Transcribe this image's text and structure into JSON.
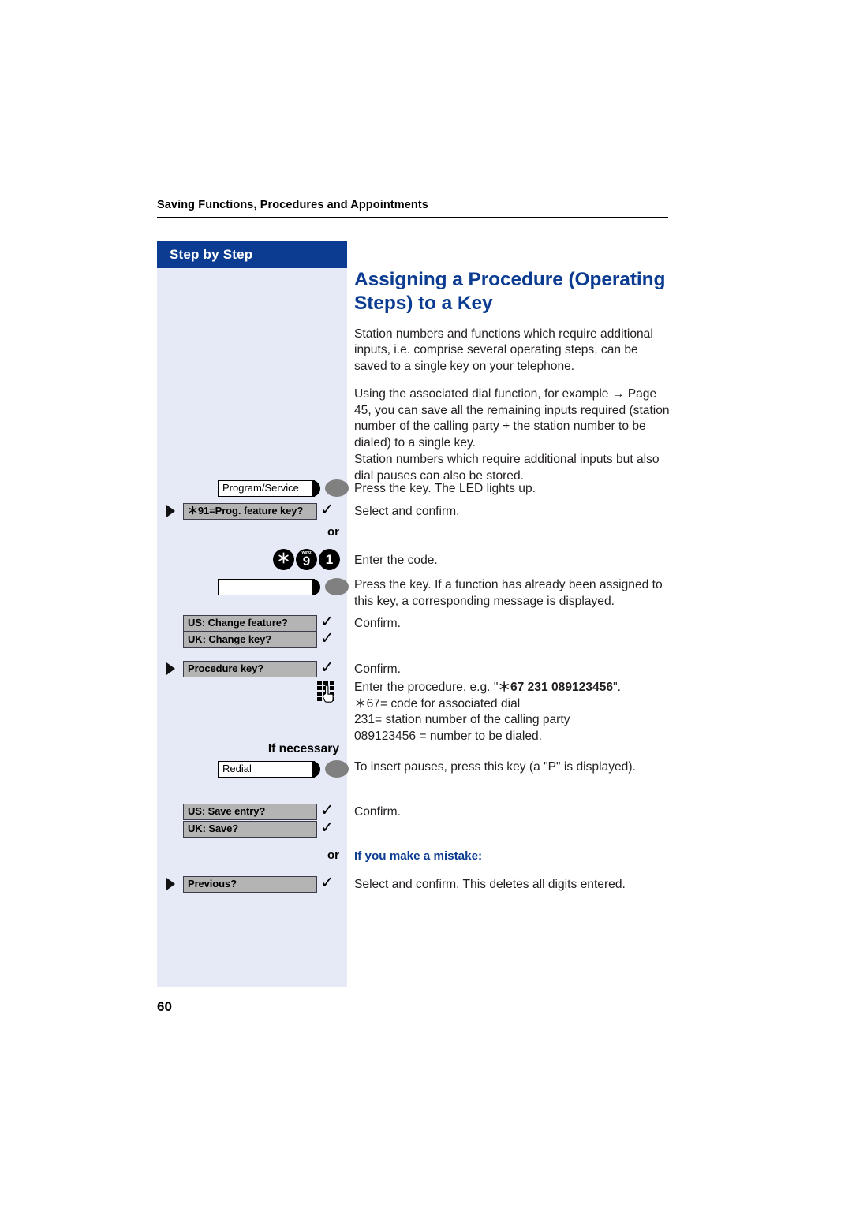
{
  "page": {
    "running_head": "Saving Functions, Procedures and Appointments",
    "folio": "60",
    "accent_blue": "#0b3c91",
    "sidebar_bg": "#e5eaf6",
    "option_box_bg": "#b4b4b4"
  },
  "sidebar": {
    "header_label": "Step by Step"
  },
  "content": {
    "title": "Assigning a Procedure (Operating Steps) to a Key",
    "paragraphs": [
      "Station numbers and functions which require additional inputs, i.e. comprise several operating steps, can be saved to a single key on your telephone.",
      "Using the associated dial function, for example → Page 45, you can save all the remaining inputs required (station number of the calling party + the station number to be dialed) to a single key.",
      "Station numbers which require additional inputs but also dial pauses can also be stored."
    ]
  },
  "steps": {
    "program_service_key": {
      "key_label": "Program/Service",
      "description": "Press the key. The LED lights up."
    },
    "prog_feature_option": {
      "label": "＊91=Prog. feature key?",
      "description": "Select and confirm."
    },
    "or_1": "or",
    "code_entry": {
      "digits": [
        {
          "glyph": "＊",
          "sub": ""
        },
        {
          "glyph": "9",
          "sub": "wxyz"
        },
        {
          "glyph": "1",
          "sub": ""
        }
      ],
      "description": "Enter the code."
    },
    "blank_key": {
      "key_label": "",
      "description": "Press the key. If a function has already been assigned to this key, a corresponding message is displayed."
    },
    "change_feature_option": {
      "label": "US: Change feature?",
      "description": "Confirm."
    },
    "change_key_option": {
      "label": "UK: Change key?"
    },
    "procedure_key_option": {
      "label": "Procedure key?",
      "description": "Confirm."
    },
    "procedure_entry": {
      "icon": "keypad-hand-icon",
      "line1_prefix": "Enter the procedure, e.g. \"",
      "line1_code": "＊67 231 089123456",
      "line1_suffix": "\".",
      "line2": "＊67= code for associated dial",
      "line3": "231= station number of the calling party",
      "line4": "089123456 = number to be dialed."
    },
    "if_necessary_label": "If necessary",
    "redial_key": {
      "key_label": "Redial",
      "description": "To insert pauses, press this key (a \"P\" is displayed)."
    },
    "save_entry_option": {
      "label": "US: Save entry?",
      "description": "Confirm."
    },
    "save_option": {
      "label": "UK: Save?"
    },
    "or_2": "or",
    "mistake_heading": "If you make a mistake:",
    "previous_option": {
      "label": "Previous?",
      "description": "Select and confirm. This deletes all digits entered."
    }
  }
}
